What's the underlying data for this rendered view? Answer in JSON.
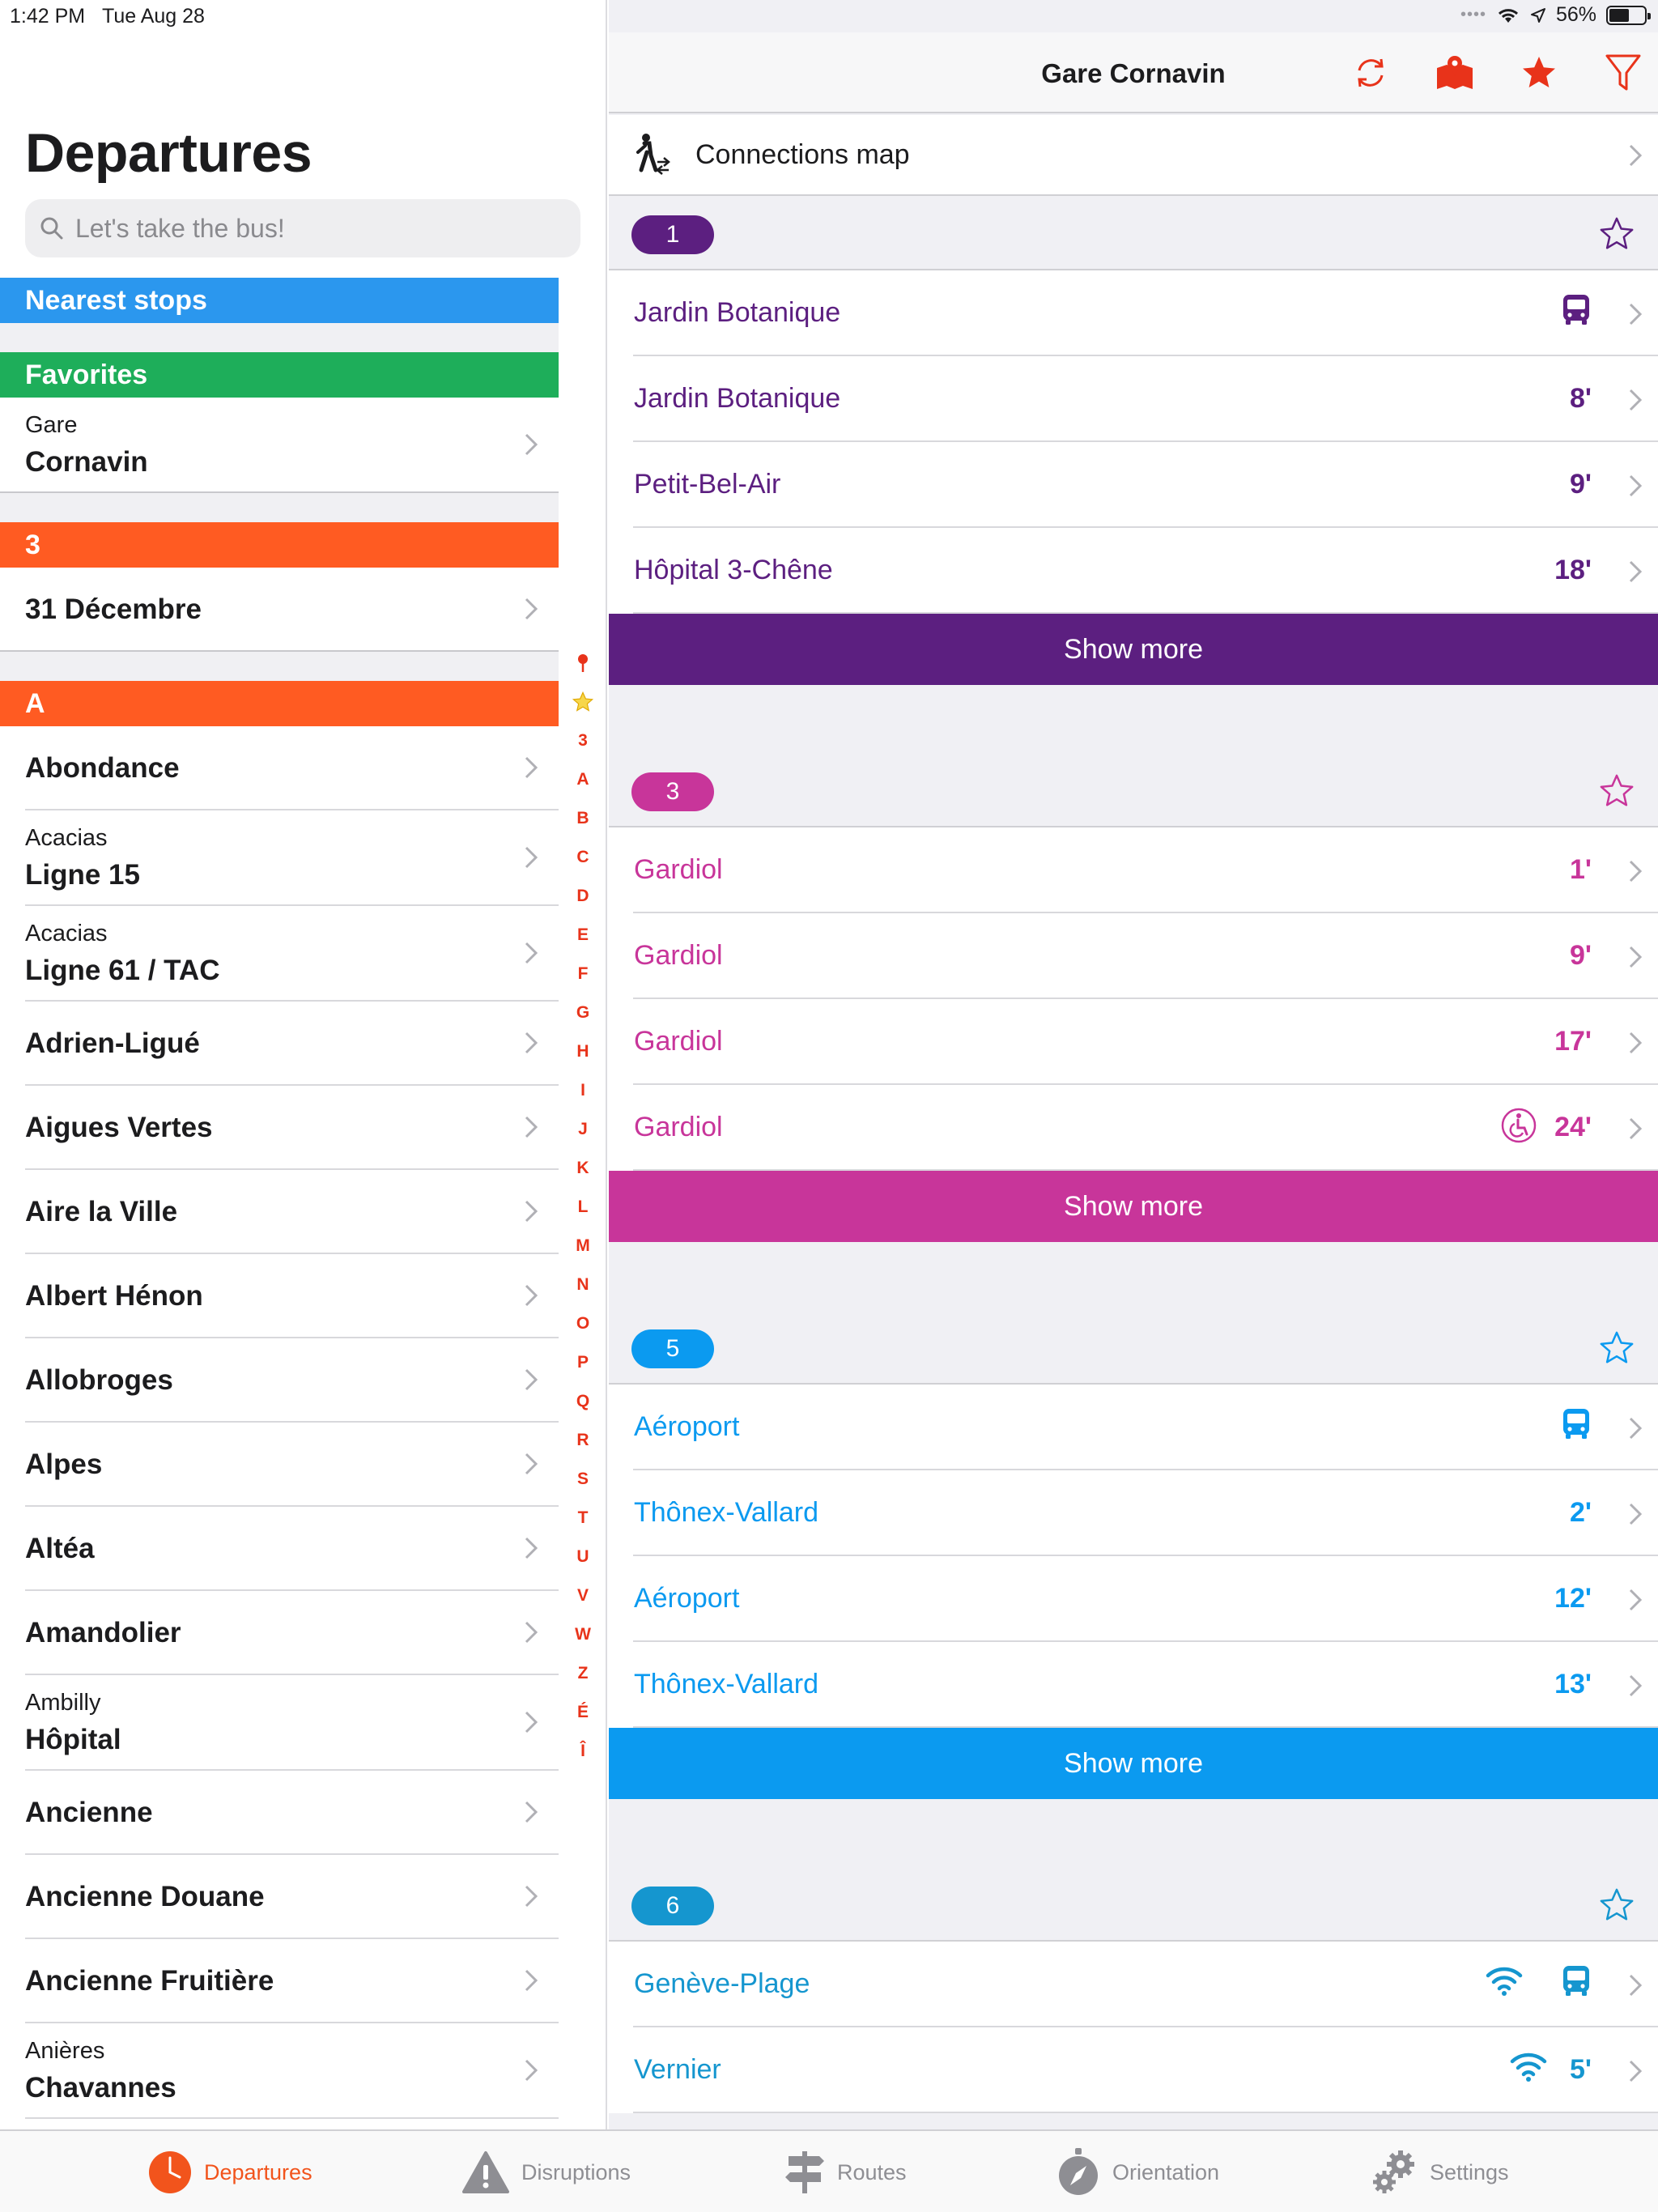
{
  "status": {
    "time": "1:42 PM",
    "date": "Tue Aug 28",
    "battery": "56%",
    "battery_level": 0.56
  },
  "left": {
    "title": "Departures",
    "search_placeholder": "Let's take the bus!",
    "sections": {
      "nearest": "Nearest stops",
      "favorites": "Favorites",
      "three": "3",
      "a": "A"
    },
    "favorites": [
      {
        "sub": "Gare",
        "name": "Cornavin"
      }
    ],
    "three_items": [
      {
        "name": "31 Décembre"
      }
    ],
    "a_items": [
      {
        "sub": "",
        "name": "Abondance"
      },
      {
        "sub": "Acacias",
        "name": "Ligne 15"
      },
      {
        "sub": "Acacias",
        "name": "Ligne 61 / TAC"
      },
      {
        "sub": "",
        "name": "Adrien-Ligué"
      },
      {
        "sub": "",
        "name": "Aigues Vertes"
      },
      {
        "sub": "",
        "name": "Aire la Ville"
      },
      {
        "sub": "",
        "name": "Albert Hénon"
      },
      {
        "sub": "",
        "name": "Allobroges"
      },
      {
        "sub": "",
        "name": "Alpes"
      },
      {
        "sub": "",
        "name": "Altéa"
      },
      {
        "sub": "",
        "name": "Amandolier"
      },
      {
        "sub": "Ambilly",
        "name": "Hôpital"
      },
      {
        "sub": "",
        "name": "Ancienne"
      },
      {
        "sub": "",
        "name": "Ancienne Douane"
      },
      {
        "sub": "",
        "name": "Ancienne Fruitière"
      },
      {
        "sub": "Anières",
        "name": "Chavannes"
      }
    ],
    "index": [
      "3",
      "A",
      "B",
      "C",
      "D",
      "E",
      "F",
      "G",
      "H",
      "I",
      "J",
      "K",
      "L",
      "M",
      "N",
      "O",
      "P",
      "Q",
      "R",
      "S",
      "T",
      "U",
      "V",
      "W",
      "Z",
      "É",
      "Î"
    ]
  },
  "right": {
    "title": "Gare Cornavin",
    "connections_label": "Connections map",
    "show_more": "Show more",
    "lines": [
      {
        "number": "1",
        "color": "#5c1f80",
        "departures": [
          {
            "dest": "Jardin Botanique",
            "time": "",
            "icons": [
              "bus-icon"
            ]
          },
          {
            "dest": "Jardin Botanique",
            "time": "8'",
            "icons": []
          },
          {
            "dest": "Petit-Bel-Air",
            "time": "9'",
            "icons": []
          },
          {
            "dest": "Hôpital 3-Chêne",
            "time": "18'",
            "icons": []
          }
        ]
      },
      {
        "number": "3",
        "color": "#c8359a",
        "departures": [
          {
            "dest": "Gardiol",
            "time": "1'",
            "icons": []
          },
          {
            "dest": "Gardiol",
            "time": "9'",
            "icons": []
          },
          {
            "dest": "Gardiol",
            "time": "17'",
            "icons": []
          },
          {
            "dest": "Gardiol",
            "time": "24'",
            "icons": [
              "wheelchair-icon"
            ]
          }
        ]
      },
      {
        "number": "5",
        "color": "#0b9af0",
        "departures": [
          {
            "dest": "Aéroport",
            "time": "",
            "icons": [
              "bus-icon"
            ]
          },
          {
            "dest": "Thônex-Vallard",
            "time": "2'",
            "icons": []
          },
          {
            "dest": "Aéroport",
            "time": "12'",
            "icons": []
          },
          {
            "dest": "Thônex-Vallard",
            "time": "13'",
            "icons": []
          }
        ]
      },
      {
        "number": "6",
        "color": "#1596cf",
        "departures": [
          {
            "dest": "Genève-Plage",
            "time": "",
            "icons": [
              "wifi-icon",
              "bus-icon"
            ]
          },
          {
            "dest": "Vernier",
            "time": "5'",
            "icons": [
              "wifi-icon"
            ]
          }
        ]
      }
    ]
  },
  "tabs": [
    {
      "label": "Departures",
      "icon": "clock-icon",
      "active": true
    },
    {
      "label": "Disruptions",
      "icon": "warning-icon",
      "active": false
    },
    {
      "label": "Routes",
      "icon": "signpost-icon",
      "active": false
    },
    {
      "label": "Orientation",
      "icon": "compass-icon",
      "active": false
    },
    {
      "label": "Settings",
      "icon": "gear-icon",
      "active": false
    }
  ],
  "colors": {
    "accent": "#f2541c",
    "nearest": "#2b97ee",
    "favorites": "#1eae5a",
    "section": "#ff5b22",
    "icon_red": "#e8331a"
  }
}
